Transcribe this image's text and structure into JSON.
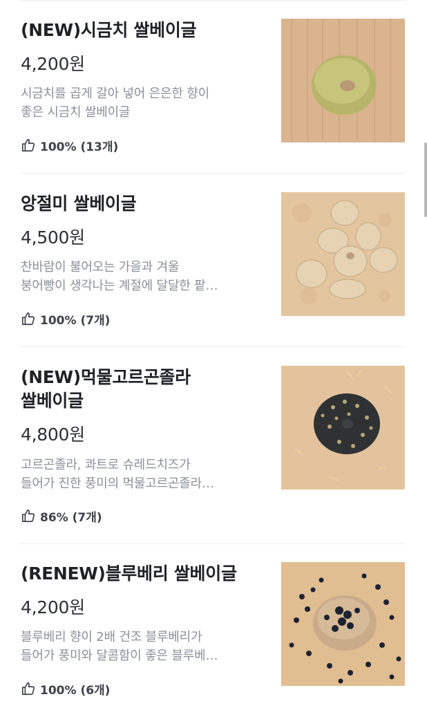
{
  "menu": {
    "items": [
      {
        "name_lines": [
          "(NEW)시금치 쌀베이글"
        ],
        "price": "4,200원",
        "description_lines": [
          "시금치를 곱게 갈아 넣어 은은한 향이",
          "좋은 시금치 쌀베이글"
        ],
        "rating": "100% (13개)",
        "photo": "spinach-bagel"
      },
      {
        "name_lines": [
          "앙절미 쌀베이글"
        ],
        "price": "4,500원",
        "description_lines": [
          "찬바람이 불어오는 가을과 겨울",
          "붕어빵이 생각나는 계절에 달달한 팥…"
        ],
        "rating": "100% (7개)",
        "photo": "injeolmi-bagel"
      },
      {
        "name_lines": [
          "(NEW)먹물고르곤졸라",
          "쌀베이글"
        ],
        "price": "4,800원",
        "description_lines": [
          "고르곤졸라, 콰트로 슈레드치즈가",
          "들어가 진한 풍미의 먹물고르곤졸라…"
        ],
        "rating": "86% (7개)",
        "photo": "squid-ink-gorgonzola-bagel"
      },
      {
        "name_lines": [
          "(RENEW)블루베리 쌀베이글"
        ],
        "price": "4,200원",
        "description_lines": [
          "블루베리 향이 2배 건조 블루베리가",
          "들어가 풍미와 달콤함이 좋은 블루베…"
        ],
        "rating": "100% (6개)",
        "photo": "blueberry-bagel"
      }
    ]
  },
  "icons": {
    "rating": "thumbs-up-icon"
  },
  "colors": {
    "text_primary": "#1f2125",
    "text_secondary": "#8a9099",
    "divider": "#ececec"
  }
}
